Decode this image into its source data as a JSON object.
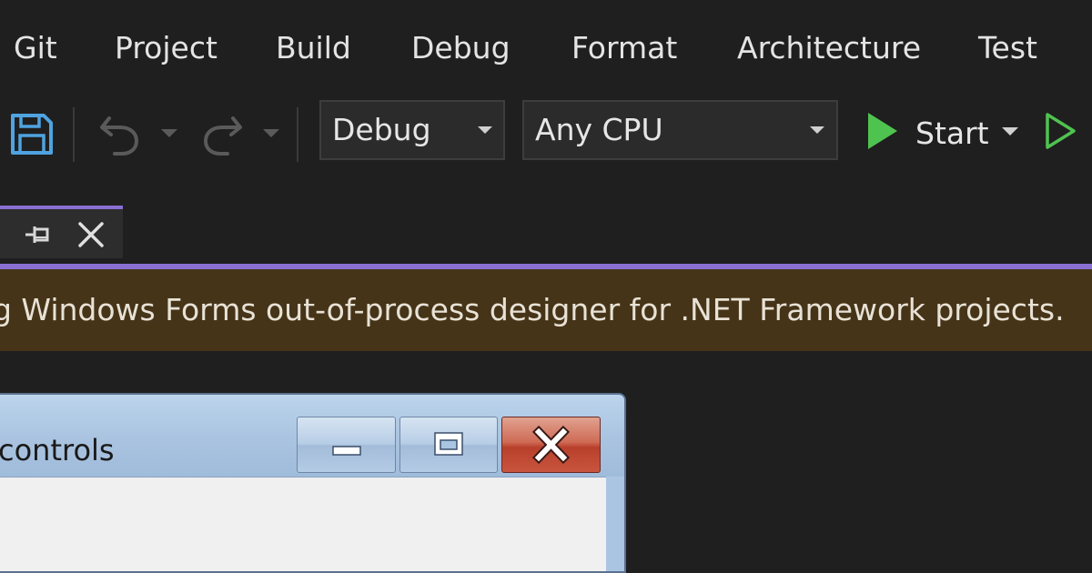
{
  "menu": {
    "items": [
      "Git",
      "Project",
      "Build",
      "Debug",
      "Format",
      "Architecture",
      "Test"
    ]
  },
  "toolbar": {
    "save_icon": "save-icon",
    "undo_icon": "undo-icon",
    "redo_icon": "redo-icon",
    "configuration": "Debug",
    "platform": "Any CPU",
    "start_label": "Start"
  },
  "tab": {
    "pin_icon": "pin-icon",
    "close_icon": "close-icon"
  },
  "infobar": {
    "message": "g Windows Forms out-of-process designer for .NET Framework projects."
  },
  "form": {
    "title": "controls"
  },
  "colors": {
    "accent": "#8a6fd3",
    "run_green": "#4fc34f",
    "infobar_bg": "#463418",
    "close_red": "#c9553f"
  }
}
